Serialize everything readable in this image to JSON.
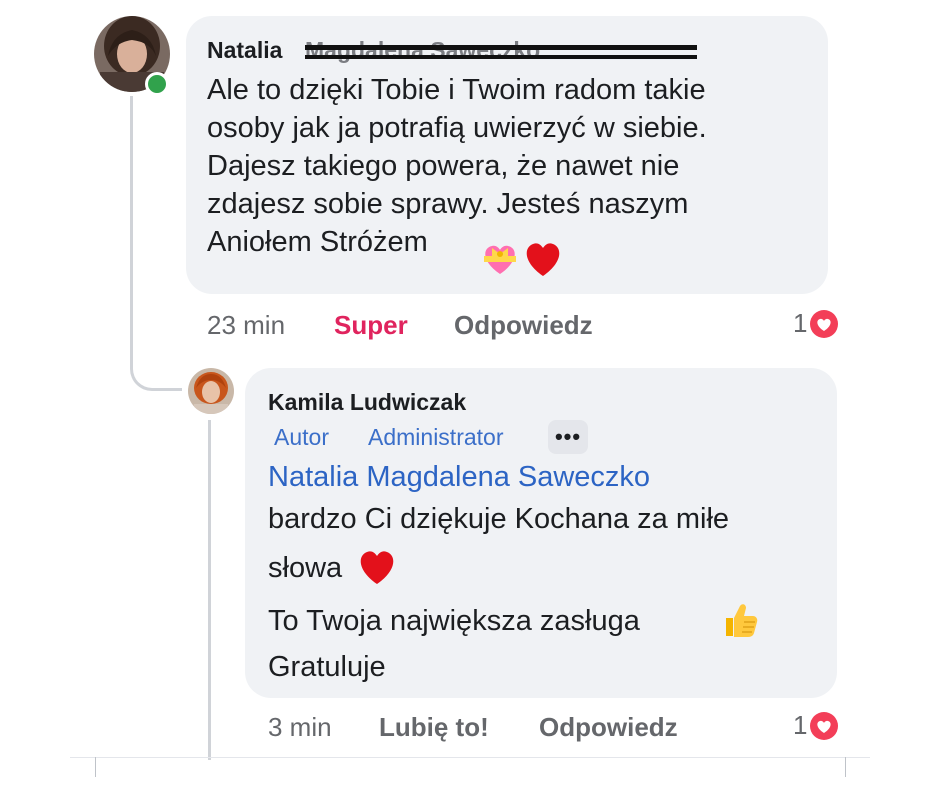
{
  "comment": {
    "author": "Natalia",
    "author_redacted": "Magdalena Saweczko",
    "text": "Ale to dzięki Tobie i Twoim radom takie\nosoby jak ja potrafią uwierzyć w siebie.\nDajesz takiego powera, że nawet nie\nzdajesz sobie sprawy. Jesteś naszym\nAniołem Stróżem",
    "emoji": [
      "heart-with-ribbon",
      "red-heart"
    ],
    "time": "23 min",
    "reaction_button": "Super",
    "reply_button": "Odpowiedz",
    "reaction_count": "1",
    "online": true
  },
  "reply": {
    "author": "Kamila Ludwiczak",
    "badges": [
      "Autor",
      "Administrator"
    ],
    "more_label": "•••",
    "mention": "Natalia Magdalena Saweczko",
    "text_line1": "bardzo Ci dziękuje Kochana za miłe",
    "text_line2": "słowa",
    "text_line3": "To Twoja największa zasługa",
    "text_line4": "Gratuluje",
    "emoji": [
      "red-heart",
      "thumbs-up"
    ],
    "time": "3 min",
    "like_button": "Lubię to!",
    "reply_button": "Odpowiedz",
    "reaction_count": "1"
  },
  "colors": {
    "bubble": "#f0f2f5",
    "link": "#2c64c4",
    "super": "#e0245e",
    "love": "#f33e58",
    "online": "#31a24c"
  }
}
